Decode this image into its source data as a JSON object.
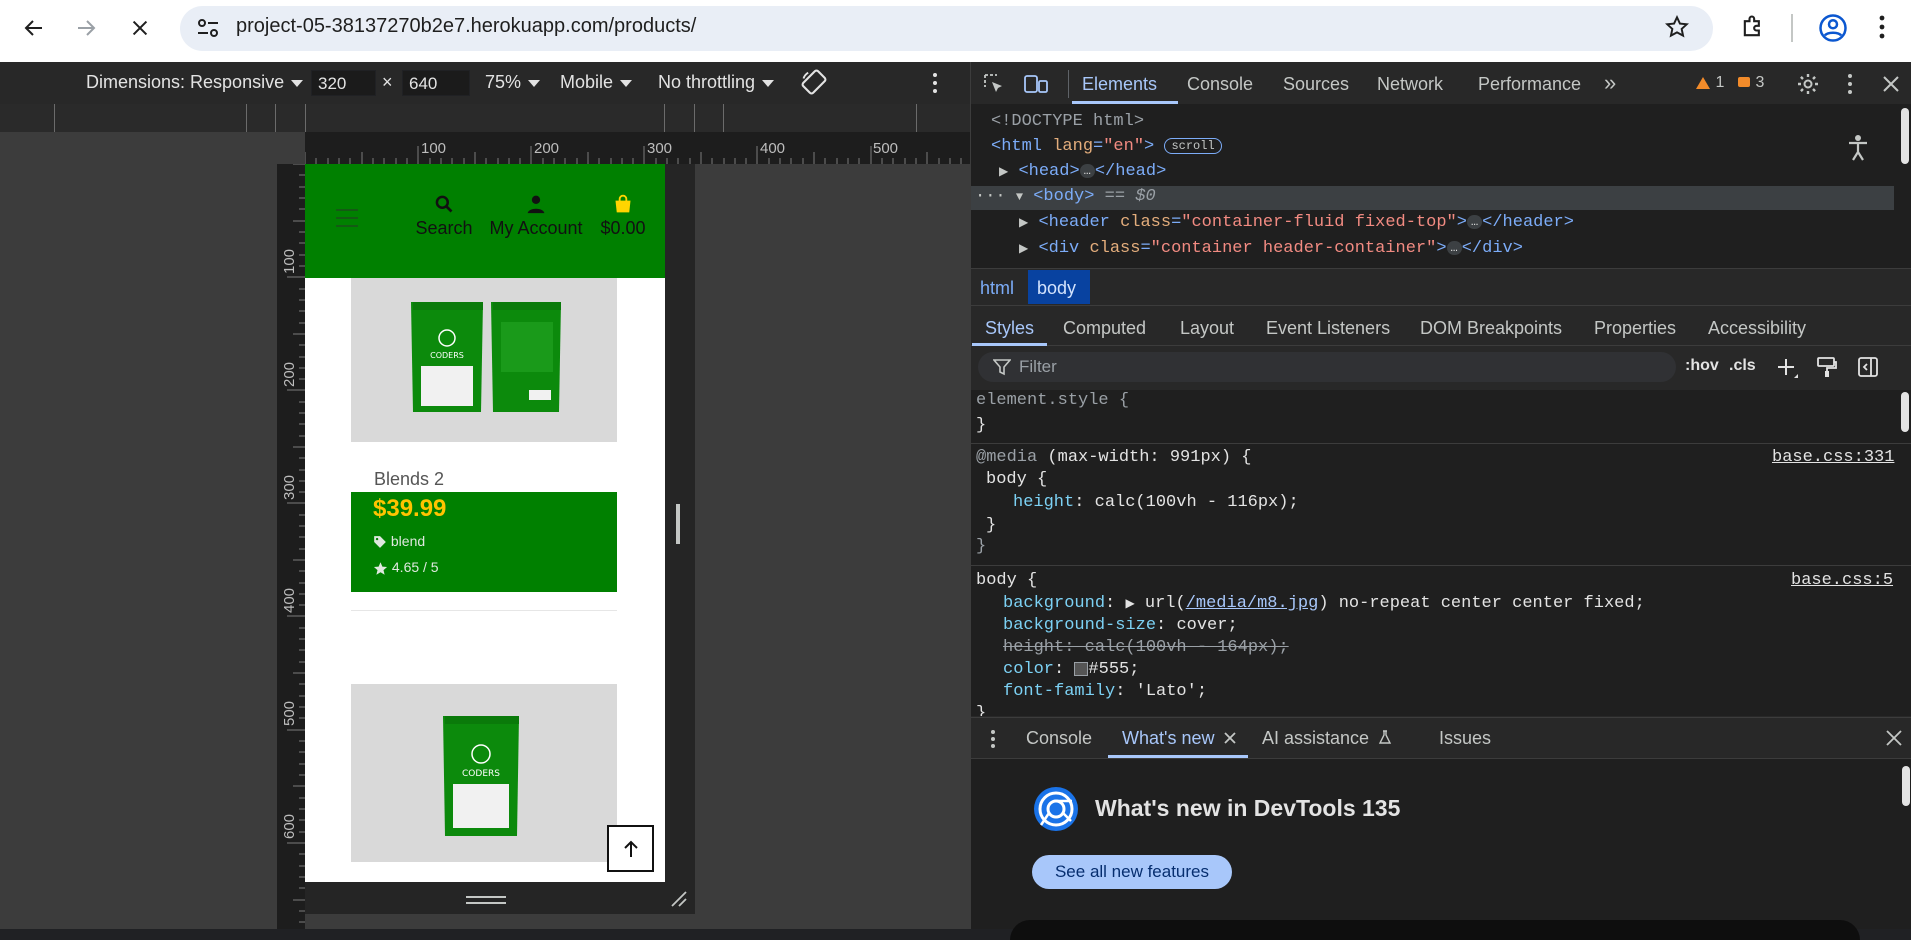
{
  "browser": {
    "url": "project-05-38137270b2e7.herokuapp.com/products/"
  },
  "device_toolbar": {
    "dimensions_label": "Dimensions: Responsive",
    "width_value": "320",
    "times": "×",
    "height_value": "640",
    "zoom": "75%",
    "device_type": "Mobile",
    "throttling": "No throttling"
  },
  "rulers": {
    "horizontal": [
      "100",
      "200",
      "300",
      "400",
      "500"
    ],
    "vertical": [
      "100",
      "200",
      "300",
      "400",
      "500",
      "600"
    ]
  },
  "site": {
    "nav": {
      "search_label": "Search",
      "account_label": "My Account",
      "cart_total": "$0.00"
    },
    "product": {
      "title": "Blends 2",
      "price": "$39.99",
      "category": "blend",
      "rating": "4.65 / 5"
    },
    "colors": {
      "header": "#008000",
      "price": "#ffc400"
    }
  },
  "devtools": {
    "tabs": [
      "Elements",
      "Console",
      "Sources",
      "Network",
      "Performance"
    ],
    "more_tabs": "»",
    "warnings_count": "1",
    "issues_count": "3",
    "elements": {
      "doctype": "<!DOCTYPE html>",
      "html_open": "<html",
      "html_attr": "lang",
      "html_attr_value": "\"en\"",
      "html_close": ">",
      "html_badge": "scroll",
      "head_open": "<head>",
      "head_close": "</head>",
      "body_tag": "<body>",
      "body_eq": " == $0",
      "header_open": "<header",
      "header_attr": "class",
      "header_value": "\"container-fluid fixed-top\"",
      "header_close": "</header>",
      "div_open": "<div",
      "div_attr": "class",
      "div_value": "\"container header-container\"",
      "div_close": "</div>",
      "ellipsis": "…"
    },
    "breadcrumbs": [
      "html",
      "body"
    ],
    "subtabs": [
      "Styles",
      "Computed",
      "Layout",
      "Event Listeners",
      "DOM Breakpoints",
      "Properties",
      "Accessibility"
    ],
    "filter_placeholder": "Filter",
    "hov": ":hov",
    "cls": ".cls",
    "styles": {
      "element_style": "element.style {",
      "close_brace": "}",
      "media_at": "@media",
      "media_query": " (max-width: 991px) {",
      "media_source": "base.css:331",
      "body_selector": "body {",
      "height_prop": "height",
      "height_val": "calc(100vh - 116px);",
      "body_source": "base.css:5",
      "bg_prop": "background",
      "bg_val_pre": "url(",
      "bg_link": "/media/m8.jpg",
      "bg_val_post": ") no-repeat center center fixed;",
      "bgsize_prop": "background-size",
      "bgsize_val": "cover;",
      "height2": "height: calc(100vh - 164px);",
      "color_prop": "color",
      "color_val": "#555;",
      "font_prop": "font-family",
      "font_val": "'Lato';"
    },
    "drawer": {
      "tabs": [
        "Console",
        "What's new",
        "AI assistance",
        "Issues"
      ],
      "title": "What's new in DevTools 135",
      "button": "See all new features"
    }
  }
}
